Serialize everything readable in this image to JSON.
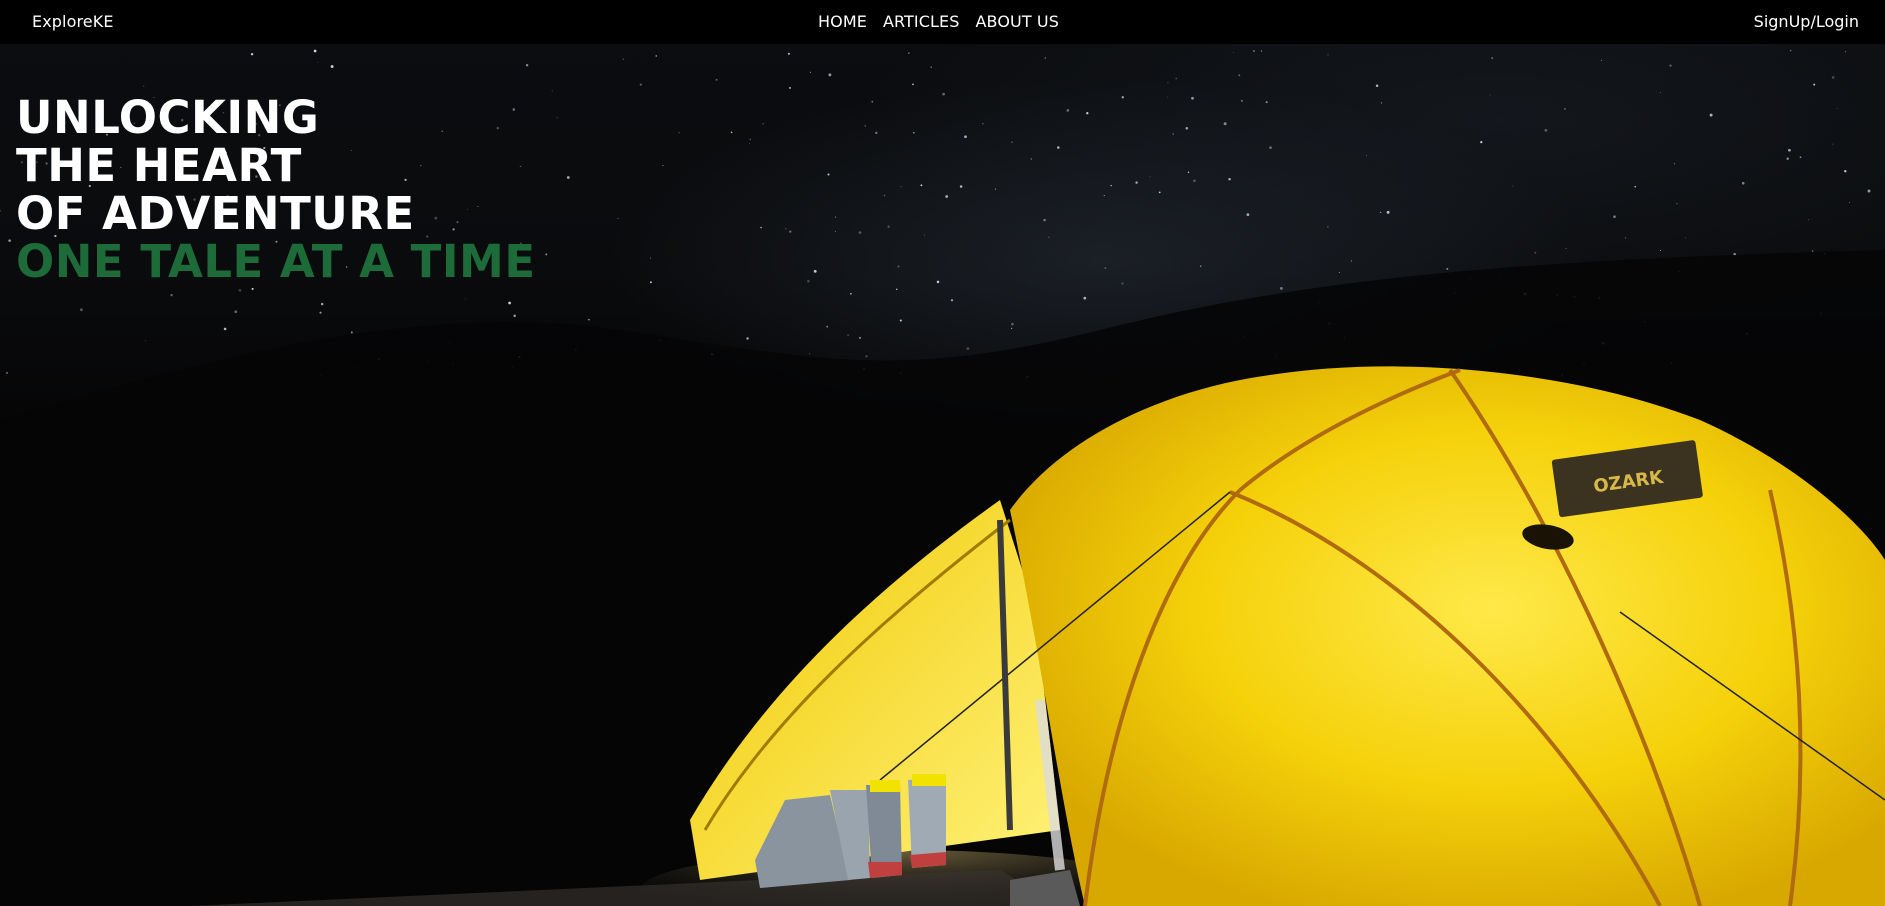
{
  "navbar": {
    "brand": "ExploreKE",
    "links": [
      {
        "label": "HOME"
      },
      {
        "label": "ARTICLES"
      },
      {
        "label": "ABOUT US"
      }
    ],
    "signup_label": "SignUp/Login"
  },
  "hero": {
    "lines": [
      "UNLOCKING",
      "THE HEART",
      "OF ADVENTURE"
    ],
    "accent_line": "ONE TALE AT A TIME",
    "tent_brand": "OZARK"
  },
  "colors": {
    "navbar_bg": "#000000",
    "accent_green": "#1e6b3a",
    "tent_yellow": "#f5d10a"
  }
}
